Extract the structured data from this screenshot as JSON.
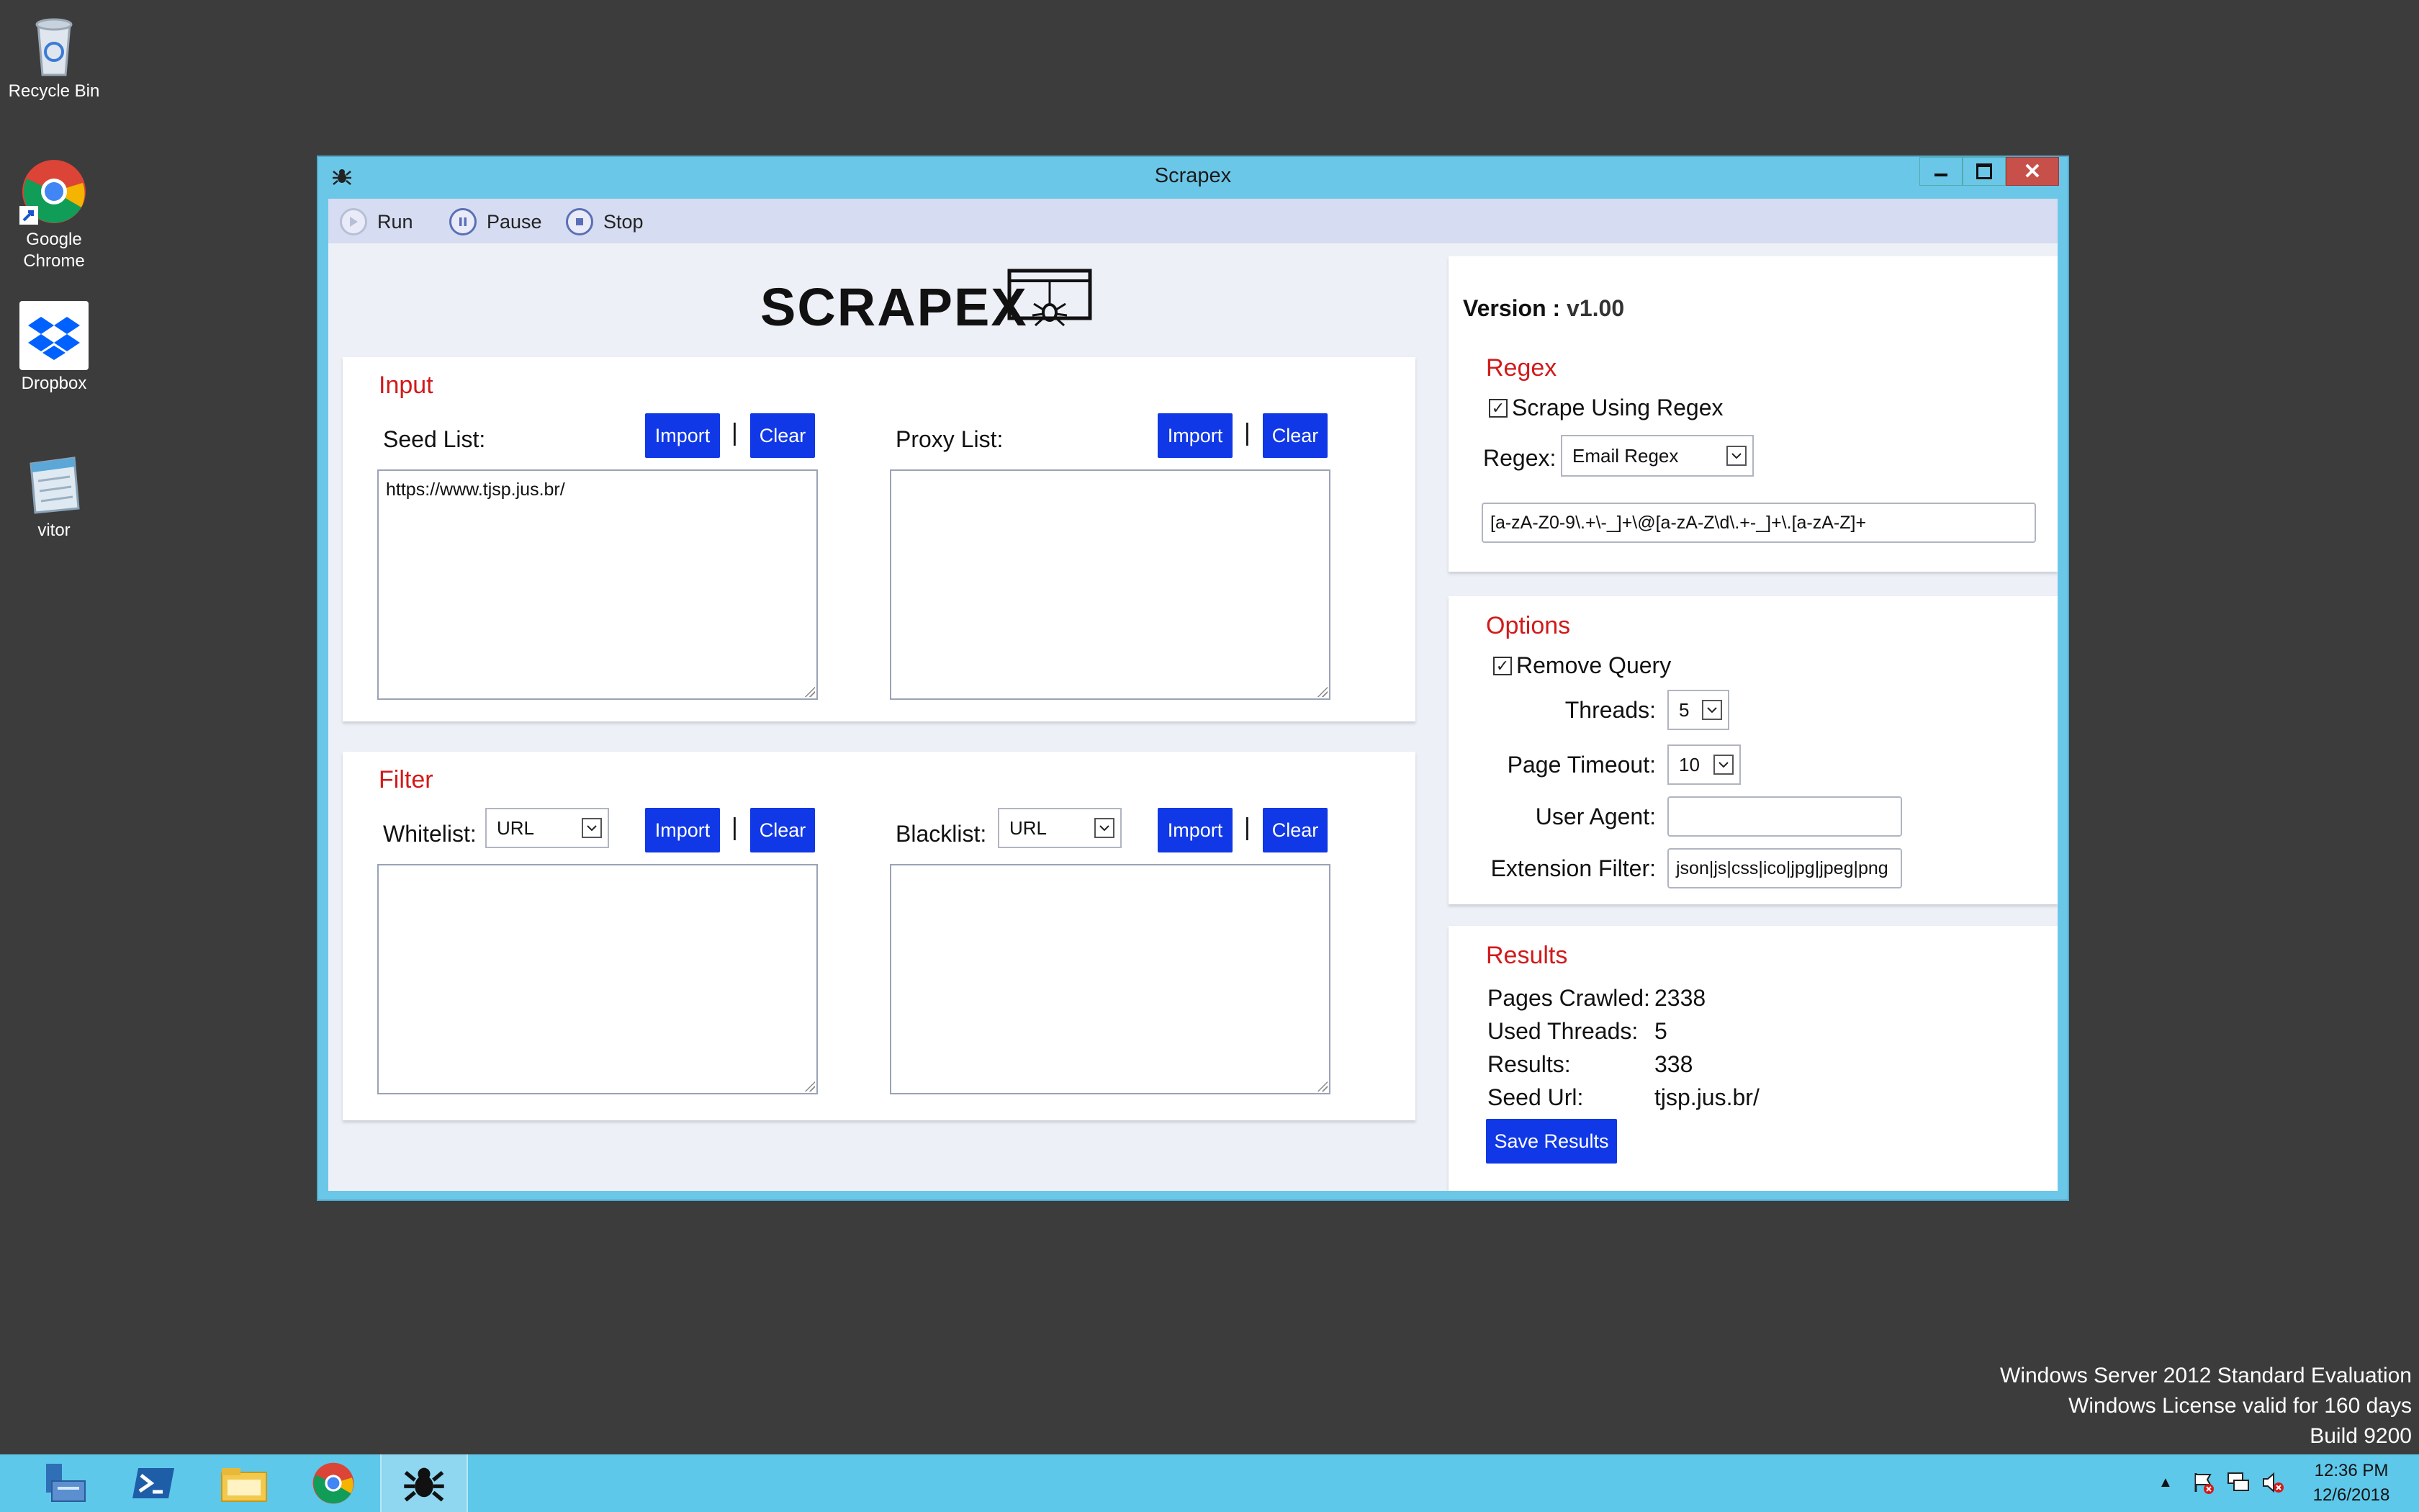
{
  "desktop": {
    "icons": [
      {
        "label": "Recycle Bin",
        "icon": "recycle-bin-icon"
      },
      {
        "label": "Google Chrome",
        "icon": "chrome-icon"
      },
      {
        "label": "Dropbox",
        "icon": "dropbox-icon"
      },
      {
        "label": "vitor",
        "icon": "notepad-icon"
      }
    ]
  },
  "window": {
    "title": "Scrapex",
    "controls": {
      "minimize": "minimize-icon",
      "maximize": "maximize-icon",
      "close": "close-icon"
    }
  },
  "toolbar": {
    "run_label": "Run",
    "pause_label": "Pause",
    "stop_label": "Stop"
  },
  "logo": {
    "text": "SCRAPEX"
  },
  "input": {
    "title": "Input",
    "seed_label": "Seed List:",
    "seed_value": "https://www.tjsp.jus.br/",
    "proxy_label": "Proxy List:",
    "proxy_value": "",
    "import_label": "Import",
    "clear_label": "Clear",
    "separator": "|"
  },
  "filter": {
    "title": "Filter",
    "whitelist_label": "Whitelist:",
    "whitelist_type": "URL",
    "blacklist_label": "Blacklist:",
    "blacklist_type": "URL",
    "import_label": "Import",
    "clear_label": "Clear",
    "separator": "|"
  },
  "version": {
    "label": "Version :",
    "value": "v1.00"
  },
  "regex": {
    "title": "Regex",
    "checkbox_label": "Scrape Using Regex",
    "checked": true,
    "select_label": "Regex:",
    "select_value": "Email Regex",
    "pattern": "[a-zA-Z0-9\\.+\\-_]+\\@[a-zA-Z\\d\\.+-_]+\\.[a-zA-Z]+"
  },
  "options": {
    "title": "Options",
    "remove_query_label": "Remove Query",
    "remove_query_checked": true,
    "threads_label": "Threads:",
    "threads_value": "5",
    "timeout_label": "Page Timeout:",
    "timeout_value": "10",
    "user_agent_label": "User Agent:",
    "user_agent_value": "",
    "extension_label": "Extension Filter:",
    "extension_value": "json|js|css|ico|jpg|jpeg|png"
  },
  "results": {
    "title": "Results",
    "pages_label": "Pages Crawled:",
    "pages_value": "2338",
    "threads_label": "Used Threads:",
    "threads_value": "5",
    "results_label": "Results:",
    "results_value": "338",
    "seed_label": "Seed Url:",
    "seed_value": "tjsp.jus.br/",
    "save_label": "Save Results"
  },
  "watermark": {
    "line1": "Windows Server 2012 Standard Evaluation",
    "line2": "Windows License valid for 160 days",
    "line3": "Build 9200"
  },
  "taskbar": {
    "apps": [
      "server-manager-icon",
      "powershell-icon",
      "file-explorer-icon",
      "chrome-icon",
      "scrapex-icon"
    ],
    "time": "12:36 PM",
    "date": "12/6/2018"
  },
  "colors": {
    "accent": "#1038e6",
    "section_title": "#d11a1a",
    "window_frame": "#6bc7e8",
    "taskbar": "#5ec8ea"
  }
}
